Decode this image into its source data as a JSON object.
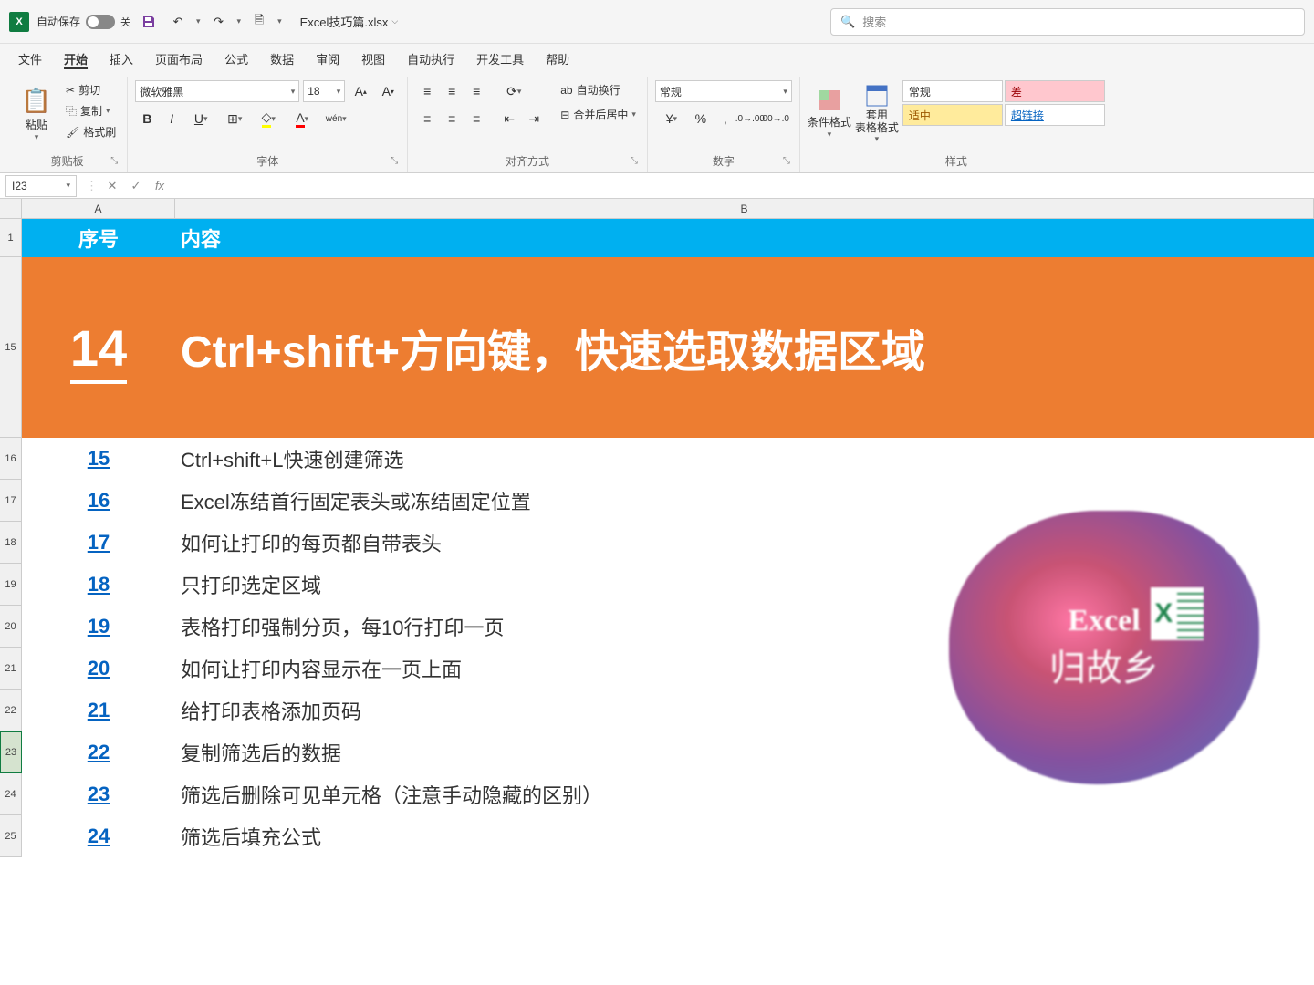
{
  "title_bar": {
    "autosave_label": "自动保存",
    "autosave_state": "关",
    "filename": "Excel技巧篇.xlsx",
    "search_placeholder": "搜索"
  },
  "menu_tabs": [
    "文件",
    "开始",
    "插入",
    "页面布局",
    "公式",
    "数据",
    "审阅",
    "视图",
    "自动执行",
    "开发工具",
    "帮助"
  ],
  "active_tab": "开始",
  "ribbon": {
    "clipboard": {
      "paste": "粘贴",
      "cut": "剪切",
      "copy": "复制",
      "format_painter": "格式刷",
      "label": "剪贴板"
    },
    "font": {
      "name": "微软雅黑",
      "size": "18",
      "label": "字体",
      "wen": "wén"
    },
    "alignment": {
      "wrap": "自动换行",
      "merge": "合并后居中",
      "label": "对齐方式"
    },
    "number": {
      "format": "常规",
      "label": "数字"
    },
    "styles": {
      "cond_format": "条件格式",
      "table_format": "套用\n表格格式",
      "normal": "常规",
      "bad": "差",
      "neutral": "适中",
      "hyperlink": "超链接",
      "label": "样式"
    }
  },
  "name_box": "I23",
  "columns": [
    "A",
    "B"
  ],
  "row_headers": [
    "1",
    "15",
    "16",
    "17",
    "18",
    "19",
    "20",
    "21",
    "22",
    "23",
    "24",
    "25"
  ],
  "table": {
    "header_a": "序号",
    "header_b": "内容",
    "feature_num": "14",
    "feature_text": "Ctrl+shift+方向键，快速选取数据区域",
    "rows": [
      {
        "num": "15",
        "text": "Ctrl+shift+L快速创建筛选"
      },
      {
        "num": "16",
        "text": "Excel冻结首行固定表头或冻结固定位置"
      },
      {
        "num": "17",
        "text": "如何让打印的每页都自带表头"
      },
      {
        "num": "18",
        "text": "只打印选定区域"
      },
      {
        "num": "19",
        "text": "表格打印强制分页，每10行打印一页"
      },
      {
        "num": "20",
        "text": "如何让打印内容显示在一页上面"
      },
      {
        "num": "21",
        "text": "给打印表格添加页码"
      },
      {
        "num": "22",
        "text": "复制筛选后的数据"
      },
      {
        "num": "23",
        "text": "筛选后删除可见单元格（注意手动隐藏的区别）"
      },
      {
        "num": "24",
        "text": "筛选后填充公式"
      }
    ]
  },
  "watermark": {
    "line1": "Excel",
    "line2": "归故乡"
  }
}
